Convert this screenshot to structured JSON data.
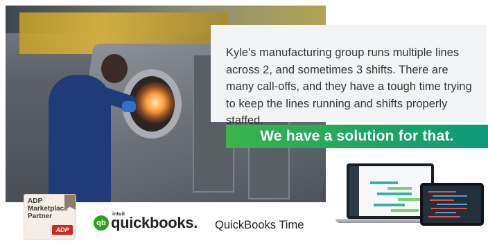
{
  "message": {
    "body": "Kyle's manufacturing group runs multiple lines across 2, and sometimes 3 shifts.  There are many call-offs, and they have a tough time trying to keep the lines running and shifts properly staffed.",
    "banner": "We have a solution for that."
  },
  "badge": {
    "title": "ADP Marketplace Partner",
    "logo_text": "ADP"
  },
  "quickbooks": {
    "icon_text": "qb",
    "intuit": "intuit",
    "wordmark": "quickbooks.",
    "time_label": "QuickBooks Time"
  },
  "colors": {
    "banner_start": "#3cb44a",
    "banner_end": "#0d9a7a",
    "quickbooks_green": "#2ca01c",
    "adp_red": "#d0271d",
    "textbox_bg": "#f2f4f6"
  },
  "icons": {
    "quickbooks_logo": "qb-circle-icon",
    "adp_logo": "adp-logo-icon"
  }
}
